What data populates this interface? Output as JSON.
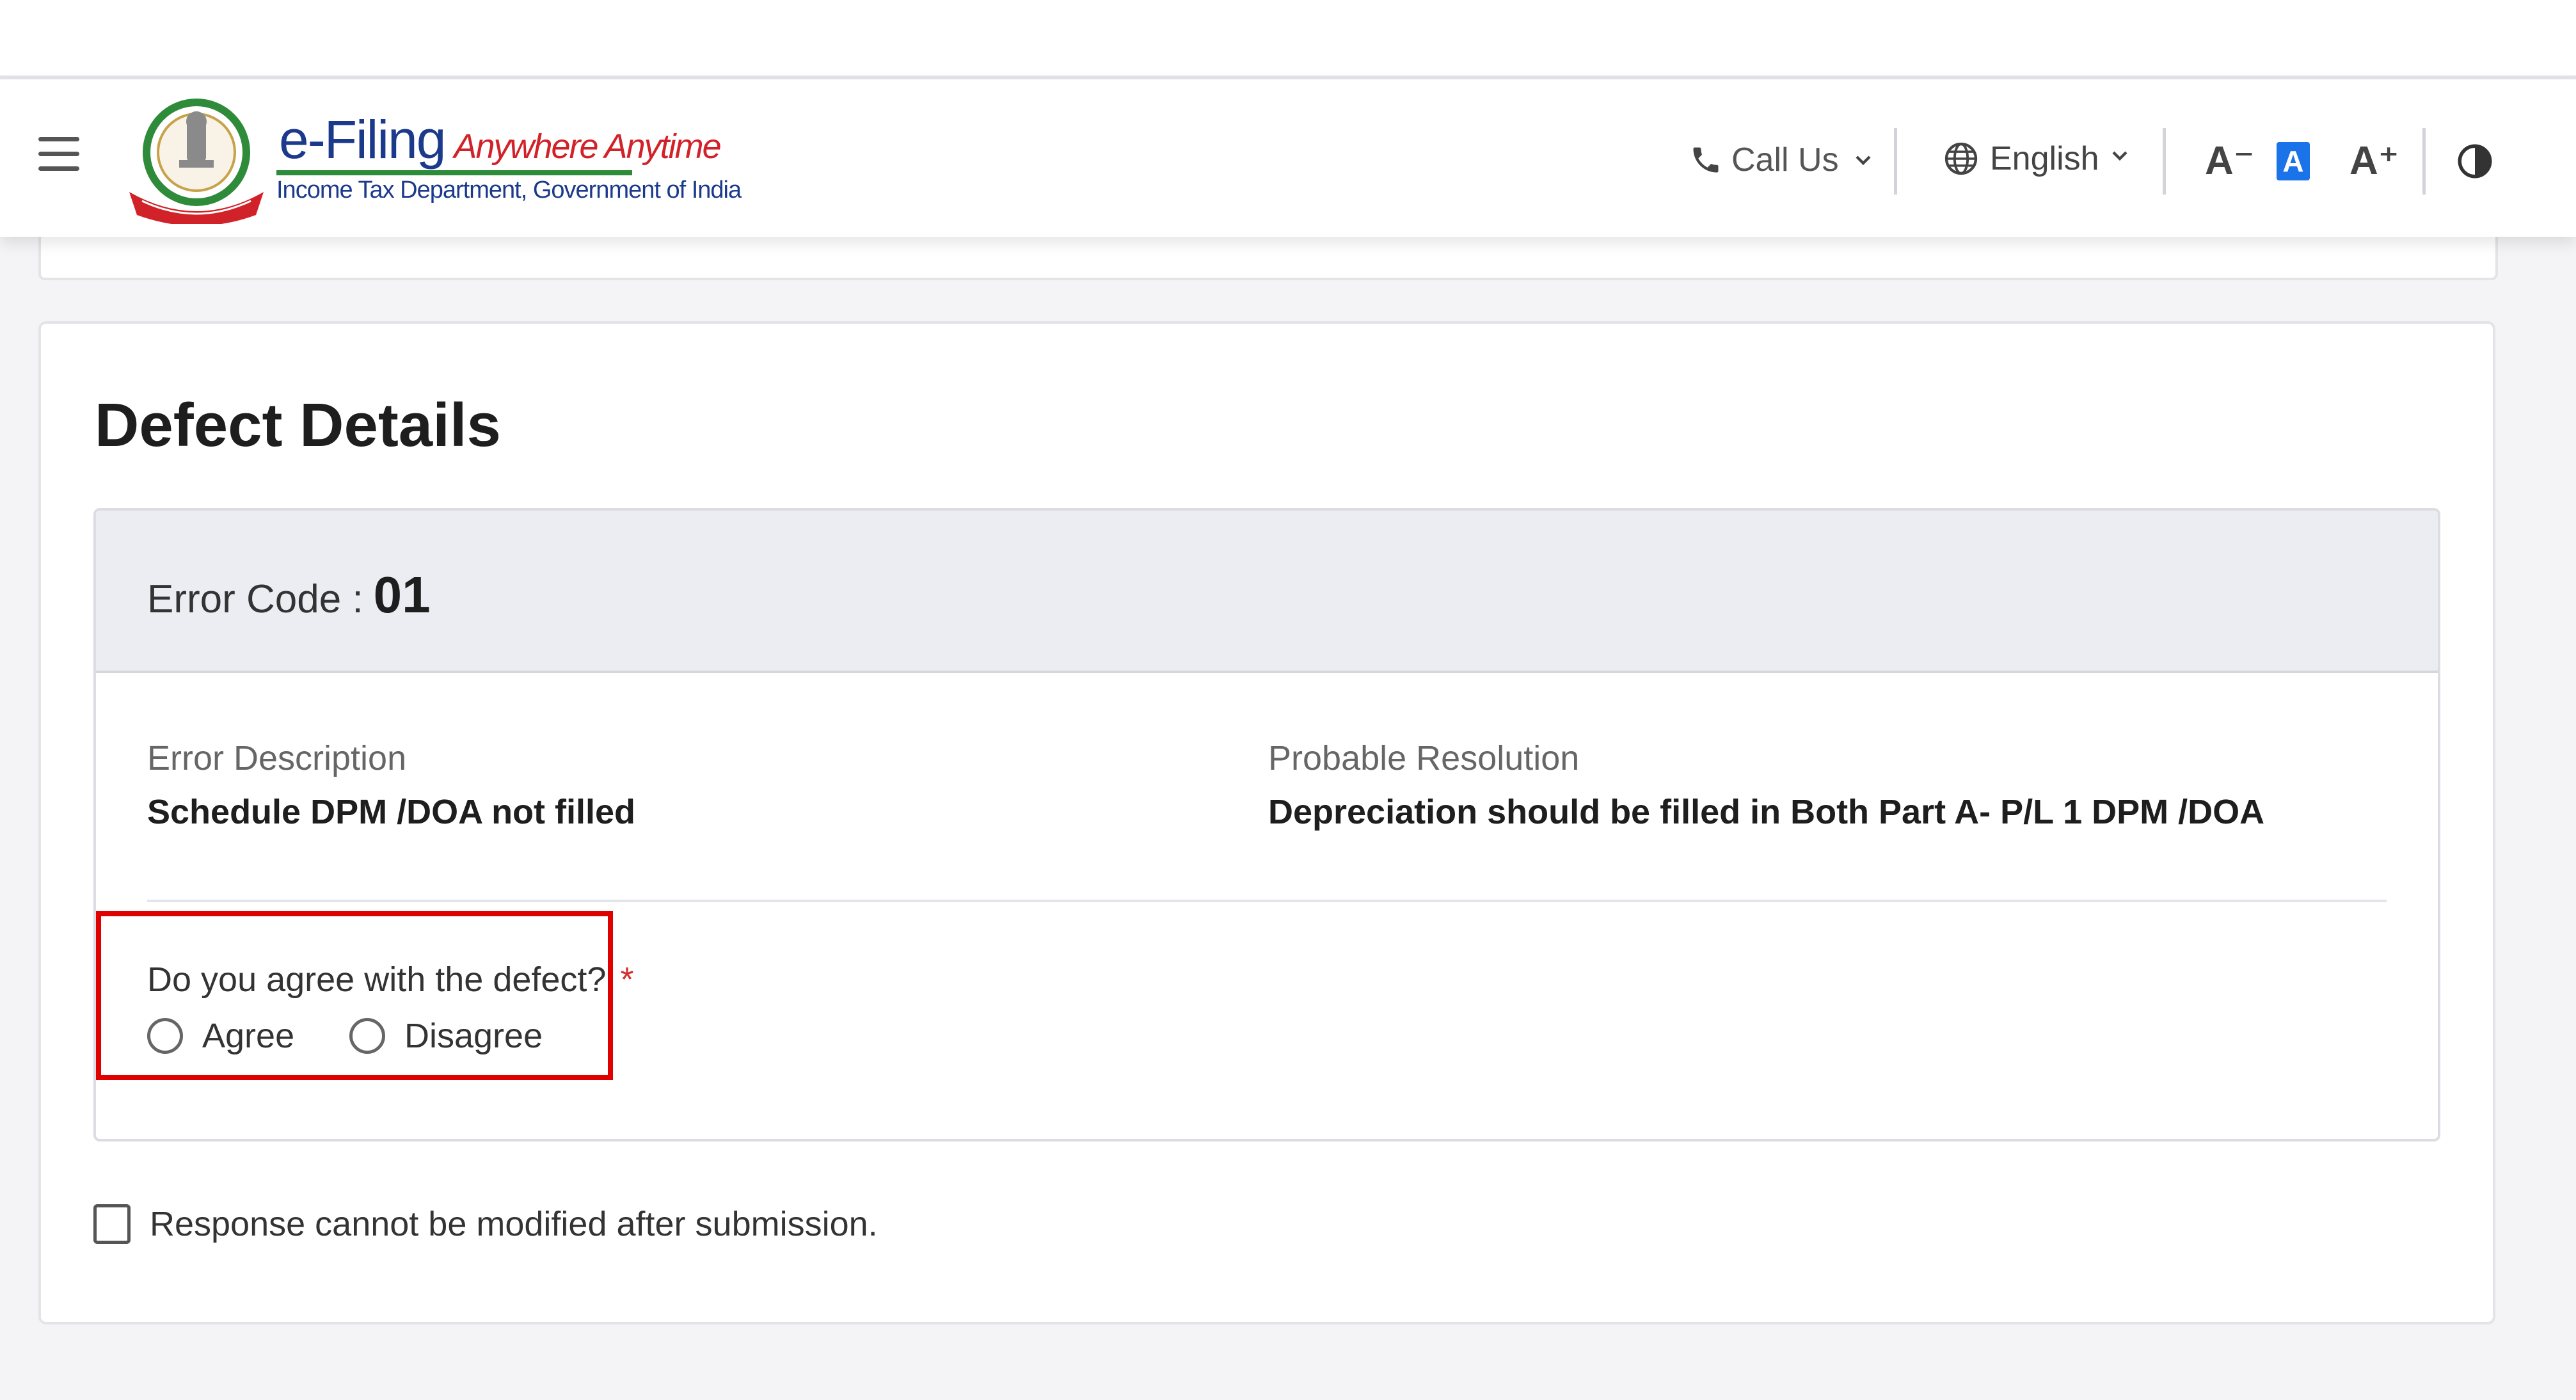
{
  "header": {
    "logo_title": "e-Filing",
    "logo_tagline": "Anywhere Anytime",
    "logo_department": "Income Tax Department, Government of India",
    "call_us": "Call Us",
    "language": "English",
    "font_decrease": "A⁻",
    "font_normal": "A",
    "font_increase": "A⁺"
  },
  "page": {
    "title": "Defect Details"
  },
  "defect": {
    "error_code_label": "Error Code :",
    "error_code_value": "01",
    "error_description_label": "Error Description",
    "error_description_value": "Schedule DPM /DOA not filled",
    "probable_resolution_label": "Probable Resolution",
    "probable_resolution_value": "Depreciation should be filled in Both Part A- P/L 1 DPM /DOA",
    "question": "Do you agree with the defect?",
    "required_mark": "*",
    "options": [
      "Agree",
      "Disagree"
    ]
  },
  "confirmation": {
    "label": "Response cannot be modified after submission."
  },
  "colors": {
    "brand_blue": "#1b3a8c",
    "accent_red": "#d22229",
    "highlight_red": "#e00000",
    "active_font_blue": "#1a73e8"
  }
}
